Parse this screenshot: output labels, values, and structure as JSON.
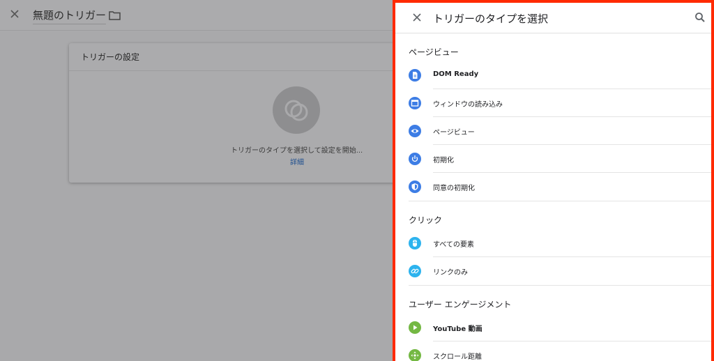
{
  "editor": {
    "title": "無題のトリガー",
    "card_title": "トリガーの設定",
    "card_hint": "トリガーのタイプを選択して設定を開始...",
    "card_link": "詳細"
  },
  "drawer": {
    "title": "トリガーのタイプを選択",
    "sections": [
      {
        "title": "ページビュー",
        "items": [
          {
            "label": "DOM Ready",
            "icon": "document-icon",
            "color": "#3d7de5",
            "bold": true
          },
          {
            "label": "ウィンドウの読み込み",
            "icon": "window-icon",
            "color": "#3d7de5",
            "bold": false
          },
          {
            "label": "ページビュー",
            "icon": "eye-icon",
            "color": "#3d7de5",
            "bold": false
          },
          {
            "label": "初期化",
            "icon": "power-icon",
            "color": "#3d7de5",
            "bold": false
          },
          {
            "label": "同意の初期化",
            "icon": "shield-icon",
            "color": "#3d7de5",
            "bold": false
          }
        ]
      },
      {
        "title": "クリック",
        "items": [
          {
            "label": "すべての要素",
            "icon": "mouse-icon",
            "color": "#2db3ee",
            "bold": false
          },
          {
            "label": "リンクのみ",
            "icon": "link-icon",
            "color": "#2db3ee",
            "bold": false
          }
        ]
      },
      {
        "title": "ユーザー エンゲージメント",
        "items": [
          {
            "label": "YouTube 動画",
            "icon": "play-icon",
            "color": "#74b843",
            "bold": true
          },
          {
            "label": "スクロール距離",
            "icon": "move-icon",
            "color": "#74b843",
            "bold": false
          }
        ]
      }
    ]
  }
}
